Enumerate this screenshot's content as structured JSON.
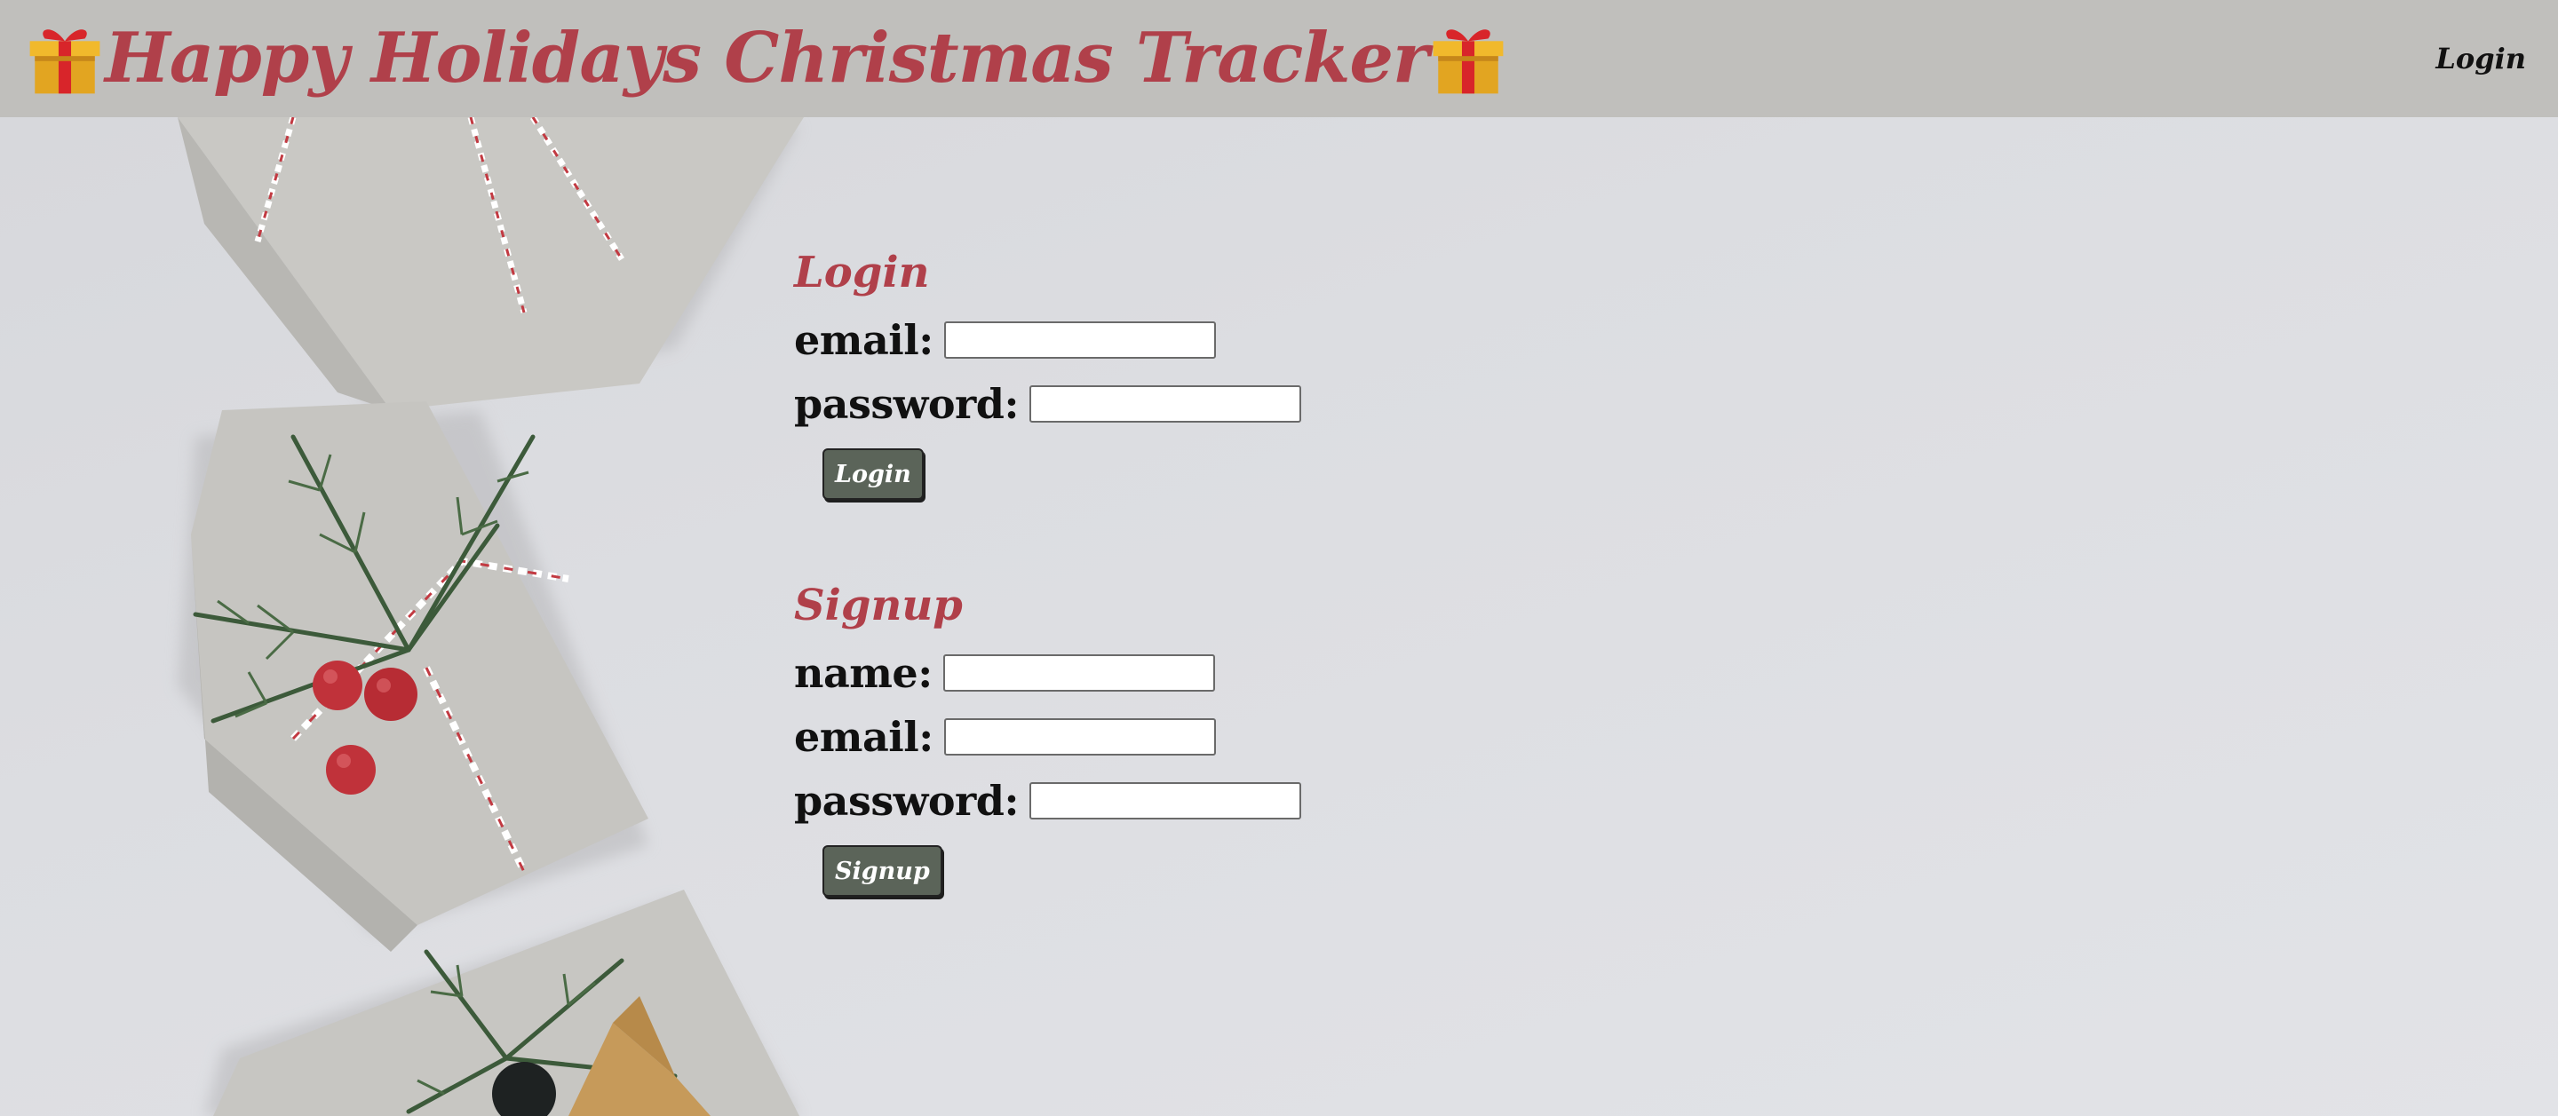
{
  "header": {
    "title": "Happy Holidays Christmas Tracker",
    "nav_login": "Login",
    "left_icon": "gift-icon",
    "right_icon": "gift-icon"
  },
  "login": {
    "heading": "Login",
    "email_label": "email:",
    "email_value": "",
    "password_label": "password:",
    "password_value": "",
    "button_label": "Login"
  },
  "signup": {
    "heading": "Signup",
    "name_label": "name:",
    "name_value": "",
    "email_label": "email:",
    "email_value": "",
    "password_label": "password:",
    "password_value": "",
    "button_label": "Signup"
  },
  "colors": {
    "accent": "#b0404a",
    "header_bg": "#c0bfbc",
    "button_bg": "#5b6459",
    "page_bg": "#dcdde1"
  }
}
